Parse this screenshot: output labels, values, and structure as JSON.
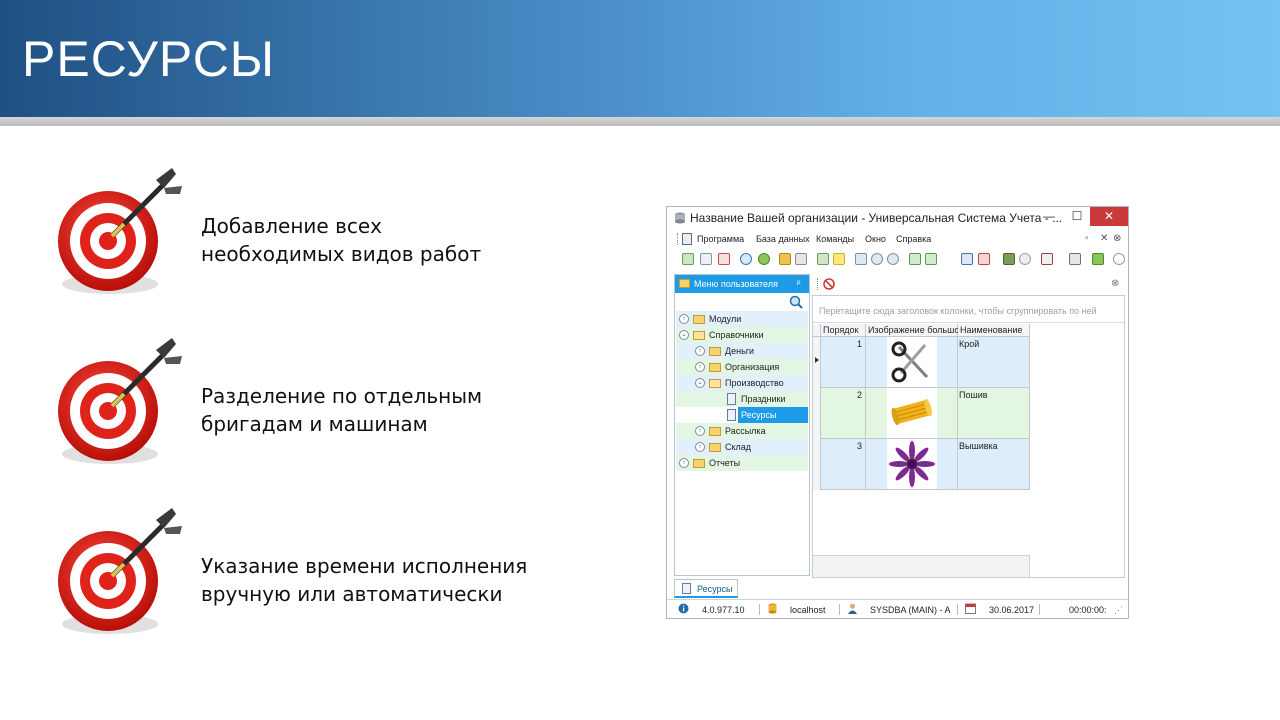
{
  "slide": {
    "title": "РЕСУРСЫ",
    "bullets": [
      {
        "line1": "Добавление всех",
        "line2": "необходимых видов работ"
      },
      {
        "line1": "Разделение по отдельным",
        "line2": "бригадам и машинам"
      },
      {
        "line1": "Указание времени исполнения",
        "line2": "вручную или автоматически"
      }
    ]
  },
  "window": {
    "title": "Название Вашей организации - Универсальная Система Учета - ...",
    "controls": {
      "minimize": "—",
      "maximize": "☐",
      "close": "✕"
    },
    "menu": [
      "Программа",
      "База данных",
      "Команды",
      "Окно",
      "Справка"
    ],
    "menu_right": {
      "restore": "▫",
      "close": "✕",
      "chevron": "⊗"
    },
    "left_panel": {
      "header": "Меню пользователя",
      "pin": "ᵖ",
      "tree": [
        {
          "label": "Модули",
          "icon": "folder",
          "expander": "›"
        },
        {
          "label": "Справочники",
          "icon": "folder-open",
          "expander": "⌄"
        },
        {
          "label": "Деньги",
          "icon": "folder",
          "expander": "›"
        },
        {
          "label": "Организация",
          "icon": "folder",
          "expander": "›"
        },
        {
          "label": "Производство",
          "icon": "folder-open",
          "expander": "⌄"
        },
        {
          "label": "Праздники",
          "icon": "document"
        },
        {
          "label": "Ресурсы",
          "icon": "document",
          "selected": true
        },
        {
          "label": "Рассылка",
          "icon": "folder",
          "expander": "›"
        },
        {
          "label": "Склад",
          "icon": "folder",
          "expander": "›"
        },
        {
          "label": "Отчеты",
          "icon": "folder",
          "expander": "›"
        }
      ]
    },
    "grid": {
      "group_hint": "Перетащите сюда заголовок колонки, чтобы сгруппировать по ней",
      "columns": [
        "Порядок",
        "Изображение большое",
        "Наименование"
      ],
      "rows": [
        {
          "order": "1",
          "image": "scissors-icon",
          "name": "Крой"
        },
        {
          "order": "2",
          "image": "thread-spool-icon",
          "name": "Пошив"
        },
        {
          "order": "3",
          "image": "flower-icon",
          "name": "Вышивка"
        }
      ]
    },
    "bottom_tab": "Ресурсы",
    "status": {
      "version": "4.0.977.10",
      "host": "localhost",
      "user": "SYSDBA (MAIN) - A",
      "date": "30.06.2017",
      "time": "00:00:00:"
    },
    "colors": {
      "accent": "#1e9be6",
      "close": "#c93a3a",
      "row_green": "#e2f6e2",
      "row_blue": "#ddeefa"
    }
  }
}
